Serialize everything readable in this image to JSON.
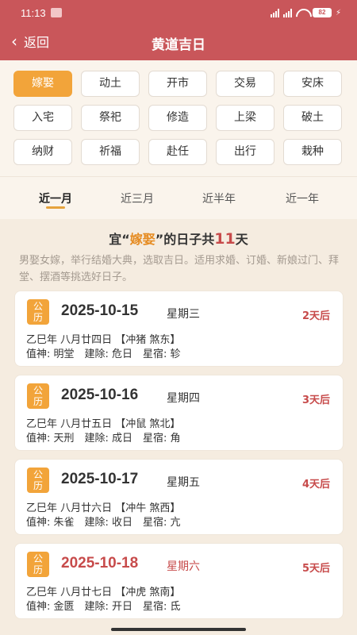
{
  "status": {
    "time": "11:13",
    "battery": "82"
  },
  "nav": {
    "back_label": "返回",
    "title": "黄道吉日"
  },
  "categories": [
    "嫁娶",
    "动土",
    "开市",
    "交易",
    "安床",
    "入宅",
    "祭祀",
    "修造",
    "上梁",
    "破土",
    "纳财",
    "祈福",
    "赴任",
    "出行",
    "栽种"
  ],
  "selected_category": "嫁娶",
  "tabs": [
    "近一月",
    "近三月",
    "近半年",
    "近一年"
  ],
  "active_tab": "近一月",
  "summary": {
    "prefix": "宜“",
    "category": "嫁娶",
    "middle": "”的日子共",
    "count": "11",
    "suffix": "天",
    "description": "男娶女嫁，举行结婚大典，选取吉日。适用求婚、订婚、新娘过门、拜堂、摆酒等挑选好日子。"
  },
  "badge_label": "公历",
  "days": [
    {
      "date": "2025-10-15",
      "weekday": "星期三",
      "countdown": "2天后",
      "lunar": "乙巳年 八月廿四日 【冲猪 煞东】",
      "deity": "值神: 明堂　建除: 危日　星宿: 轸",
      "weekend": false
    },
    {
      "date": "2025-10-16",
      "weekday": "星期四",
      "countdown": "3天后",
      "lunar": "乙巳年 八月廿五日 【冲鼠 煞北】",
      "deity": "值神: 天刑　建除: 成日　星宿: 角",
      "weekend": false
    },
    {
      "date": "2025-10-17",
      "weekday": "星期五",
      "countdown": "4天后",
      "lunar": "乙巳年 八月廿六日 【冲牛 煞西】",
      "deity": "值神: 朱雀　建除: 收日　星宿: 亢",
      "weekend": false
    },
    {
      "date": "2025-10-18",
      "weekday": "星期六",
      "countdown": "5天后",
      "lunar": "乙巳年 八月廿七日 【冲虎 煞南】",
      "deity": "值神: 金匮　建除: 开日　星宿: 氐",
      "weekend": true
    }
  ],
  "colors": {
    "header": "#c9565a",
    "accent": "#f2a43a",
    "highlight_red": "#c74b4b"
  }
}
